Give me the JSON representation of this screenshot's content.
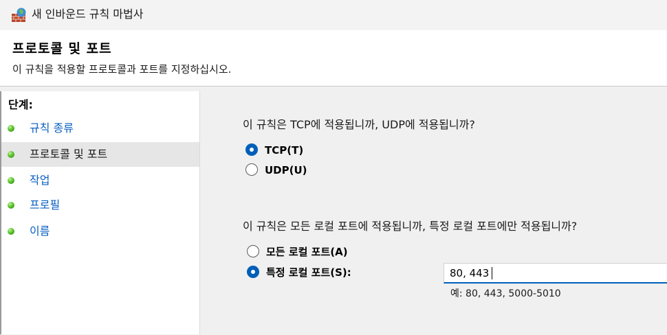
{
  "window": {
    "title": "새 인바운드 규칙 마법사",
    "icon": "firewall-wizard-icon"
  },
  "header": {
    "heading": "프로토콜 및 포트",
    "description": "이 규칙을 적용할 프로토콜과 포트를 지정하십시오."
  },
  "steps": {
    "title": "단계:",
    "items": [
      {
        "label": "규칙 종류",
        "state": "link"
      },
      {
        "label": "프로토콜 및 포트",
        "state": "current"
      },
      {
        "label": "작업",
        "state": "link"
      },
      {
        "label": "프로필",
        "state": "link"
      },
      {
        "label": "이름",
        "state": "link"
      }
    ]
  },
  "protocol": {
    "question": "이 규칙은 TCP에 적용됩니까, UDP에 적용됩니까?",
    "options": [
      {
        "label": "TCP(T)",
        "checked": true
      },
      {
        "label": "UDP(U)",
        "checked": false
      }
    ]
  },
  "ports": {
    "question": "이 규칙은 모든 로컬 포트에 적용됩니까, 특정 로컬 포트에만 적용됩니까?",
    "options": [
      {
        "label": "모든 로컬 포트(A)",
        "checked": false
      },
      {
        "label": "특정 로컬 포트(S):",
        "checked": true
      }
    ],
    "input_value": "80, 443",
    "example": "예: 80, 443, 5000-5010"
  },
  "colors": {
    "accent": "#005fb8",
    "link": "#0a5ec2",
    "step_dot": "#5cc22c"
  }
}
